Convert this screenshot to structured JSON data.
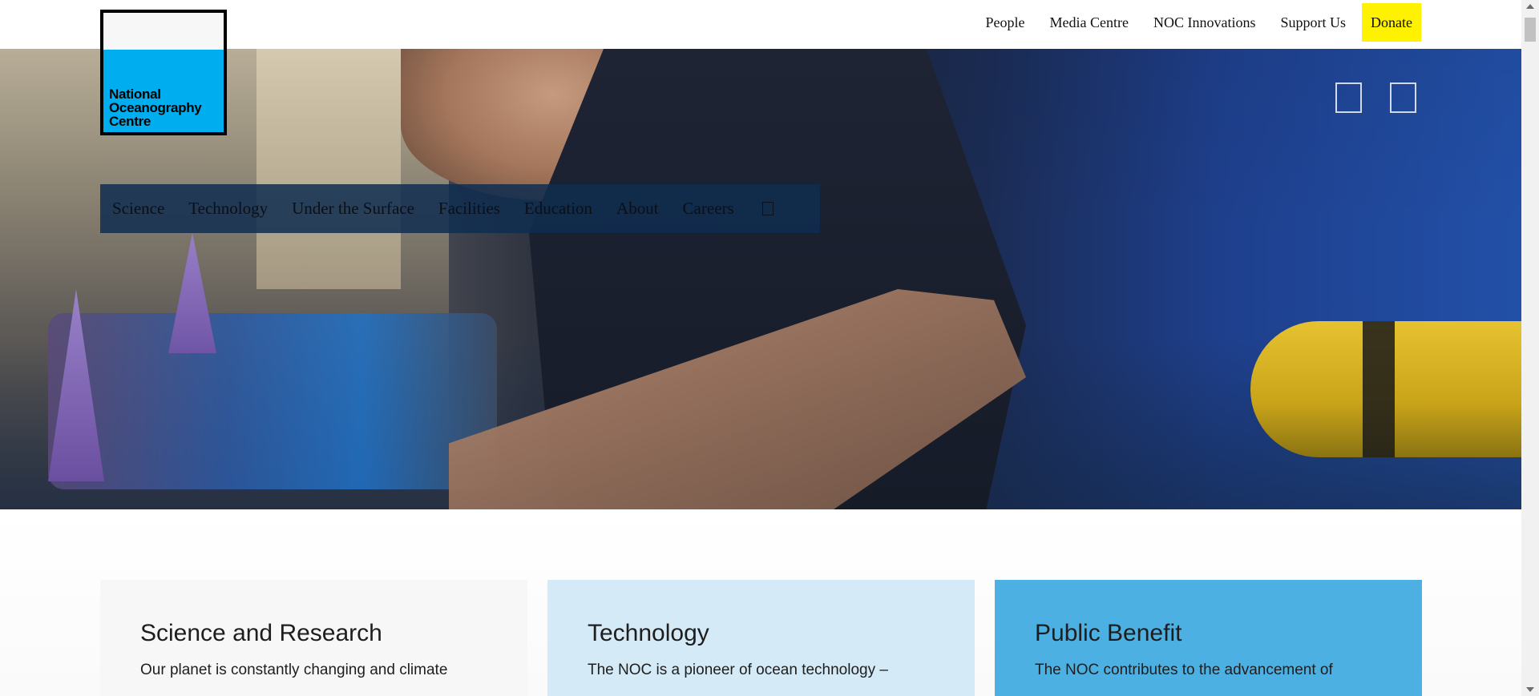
{
  "top_nav": {
    "links": [
      "People",
      "Media Centre",
      "NOC Innovations",
      "Support Us"
    ],
    "donate_label": "Donate",
    "donate_color": "#fff200"
  },
  "logo": {
    "text": "National\nOceanography\nCentre",
    "brand_color": "#00aeef"
  },
  "hero": {
    "controls": [
      "pause-icon",
      "mute-icon"
    ]
  },
  "main_nav": {
    "items": [
      "Science",
      "Technology",
      "Under the Surface",
      "Facilities",
      "Education",
      "About",
      "Careers"
    ],
    "search_icon": "search-icon"
  },
  "cards": [
    {
      "title": "Science and Research",
      "text": "Our planet is constantly changing and climate",
      "bg": "#f7f7f7"
    },
    {
      "title": "Technology",
      "text": "The NOC is a pioneer of ocean technology –",
      "bg": "#d4eaf7"
    },
    {
      "title": "Public Benefit",
      "text": "The NOC contributes to the advancement of",
      "bg": "#4db0e3"
    }
  ]
}
